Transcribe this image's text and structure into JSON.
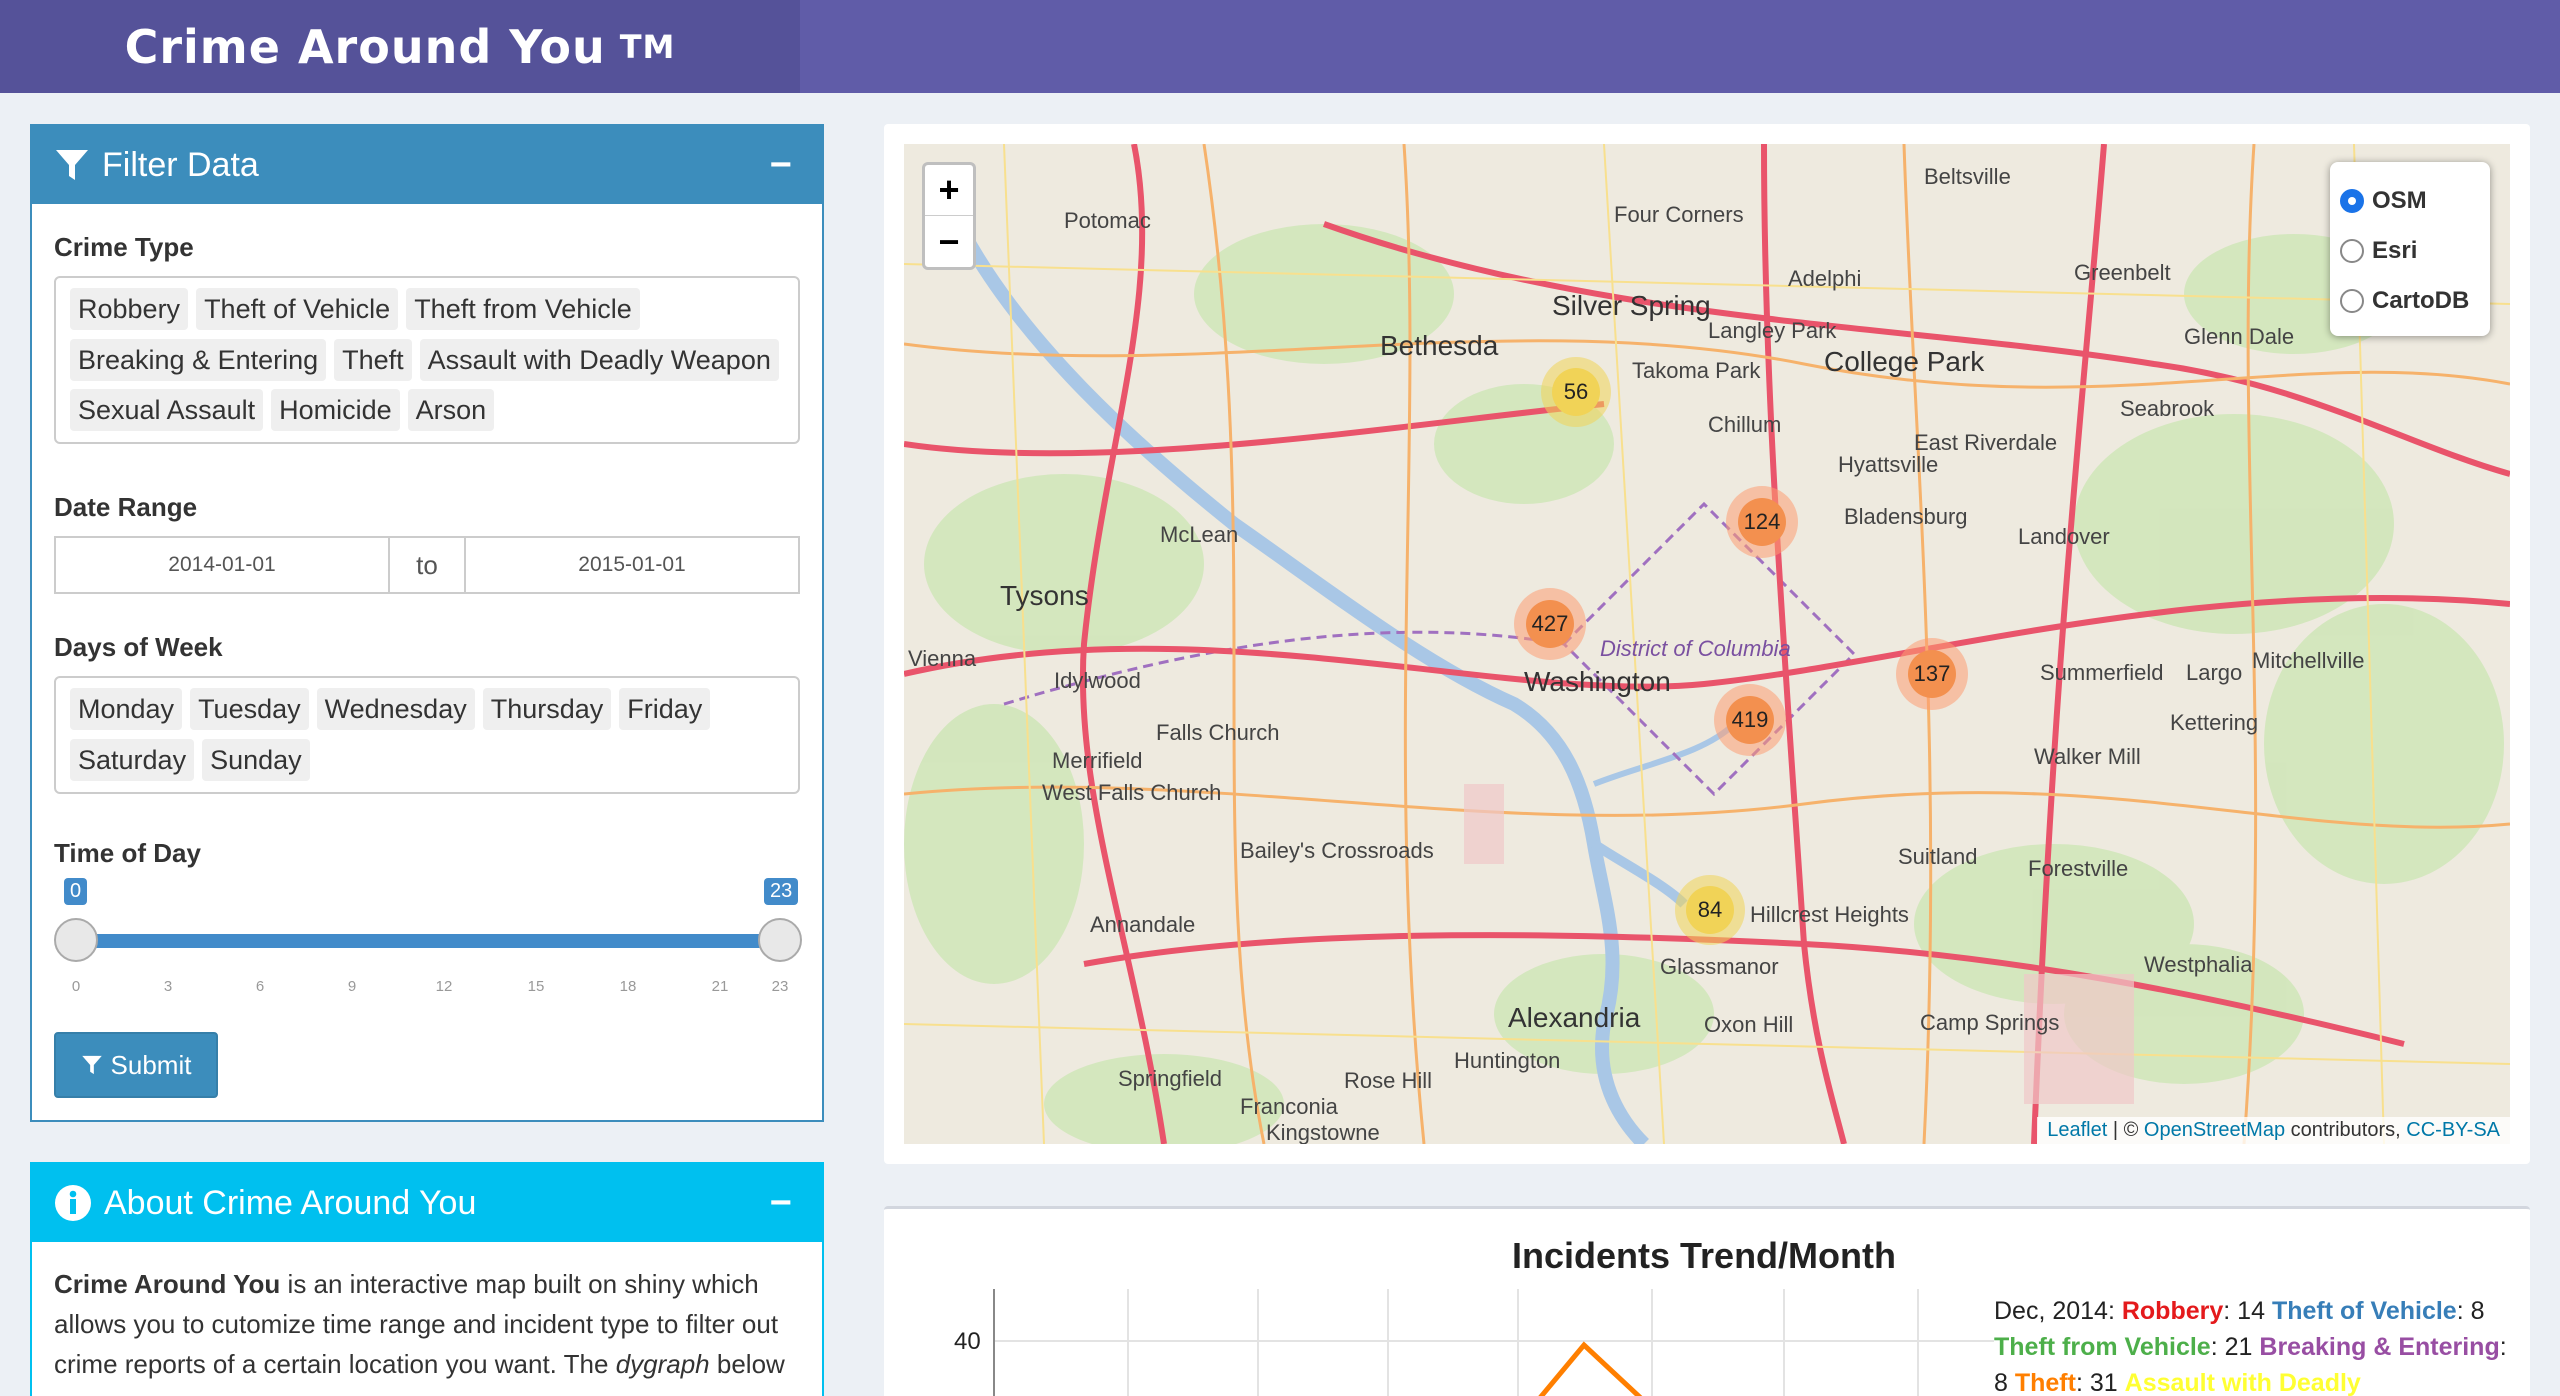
{
  "app": {
    "title": "Crime Around You",
    "tm": "TM"
  },
  "filter": {
    "title": "Filter Data",
    "collapse": "−",
    "crime_type_label": "Crime Type",
    "crime_types": [
      "Robbery",
      "Theft of Vehicle",
      "Theft from Vehicle",
      "Breaking & Entering",
      "Theft",
      "Assault with Deadly Weapon",
      "Sexual Assault",
      "Homicide",
      "Arson"
    ],
    "date_range_label": "Date Range",
    "date_start": "2014-01-01",
    "date_sep": "to",
    "date_end": "2015-01-01",
    "days_label": "Days of Week",
    "days": [
      "Monday",
      "Tuesday",
      "Wednesday",
      "Thursday",
      "Friday",
      "Saturday",
      "Sunday"
    ],
    "time_label": "Time of Day",
    "time_min_value": "0",
    "time_max_value": "23",
    "time_ticks": [
      "0",
      "3",
      "6",
      "9",
      "12",
      "15",
      "18",
      "21",
      "23"
    ],
    "submit_label": "Submit"
  },
  "about": {
    "title": "About Crime Around You",
    "collapse": "−",
    "bold_name": "Crime Around You",
    "text_1": " is an interactive map built on shiny which allows you to cutomize time range and incident type to filter out crime reports of a certain location you want. The ",
    "italic": "dygraph",
    "text_2": " below"
  },
  "map": {
    "zoom_in": "+",
    "zoom_out": "−",
    "layers": [
      {
        "label": "OSM",
        "selected": true
      },
      {
        "label": "Esri",
        "selected": false
      },
      {
        "label": "CartoDB",
        "selected": false
      }
    ],
    "attribution_leaflet": "Leaflet",
    "attribution_mid": " | © ",
    "attribution_osm": "OpenStreetMap",
    "attribution_contrib": " contributors, ",
    "attribution_license": "CC-BY-SA",
    "clusters": [
      {
        "count": "56",
        "color": "#f1d357"
      },
      {
        "count": "124",
        "color": "#fd9c73"
      },
      {
        "count": "427",
        "color": "#fd9c73"
      },
      {
        "count": "137",
        "color": "#fd9c73"
      },
      {
        "count": "419",
        "color": "#fd9c73"
      },
      {
        "count": "84",
        "color": "#f1d357"
      }
    ],
    "places": [
      "Silver Spring",
      "Bethesda",
      "College Park",
      "Takoma Park",
      "Washington",
      "District of Columbia",
      "Tysons",
      "McLean",
      "Alexandria",
      "Falls Church",
      "Annandale",
      "Springfield",
      "Hyattsville",
      "Bladensburg",
      "Landover",
      "Greenbelt",
      "Glenn Dale",
      "Seabrook",
      "Potomac",
      "Four Corners",
      "Adelphi",
      "Langley Park",
      "Chillum",
      "East Riverdale",
      "Idylwood",
      "Merrifield",
      "West Falls Church",
      "Bailey's Crossroads",
      "Vienna",
      "Walker Mill",
      "Summerfield",
      "Largo",
      "Kettering",
      "Mitchellville",
      "Suitland",
      "Forestville",
      "Hillcrest Heights",
      "Glassmanor",
      "Oxon Hill",
      "Camp Springs",
      "Westphalia",
      "Huntington",
      "Rose Hill",
      "Franconia",
      "Kingstowne",
      "Beltsville"
    ]
  },
  "chart": {
    "title": "Incidents Trend/Month",
    "y_tick": "40",
    "legend_month": "Dec, 2014: ",
    "legend": [
      {
        "name": "Robbery",
        "value": "14",
        "color": "#e41a1c"
      },
      {
        "name": "Theft of Vehicle",
        "value": "8",
        "color": "#377eb8"
      },
      {
        "name": "Theft from Vehicle",
        "value": "21",
        "color": "#4daf4a"
      },
      {
        "name": "Breaking & Entering",
        "value": "8",
        "color": "#984ea3"
      },
      {
        "name": "Theft",
        "value": "31",
        "color": "#ff7f00"
      },
      {
        "name": "Assault with Deadly",
        "value": "",
        "color": "#ffff33"
      }
    ]
  }
}
